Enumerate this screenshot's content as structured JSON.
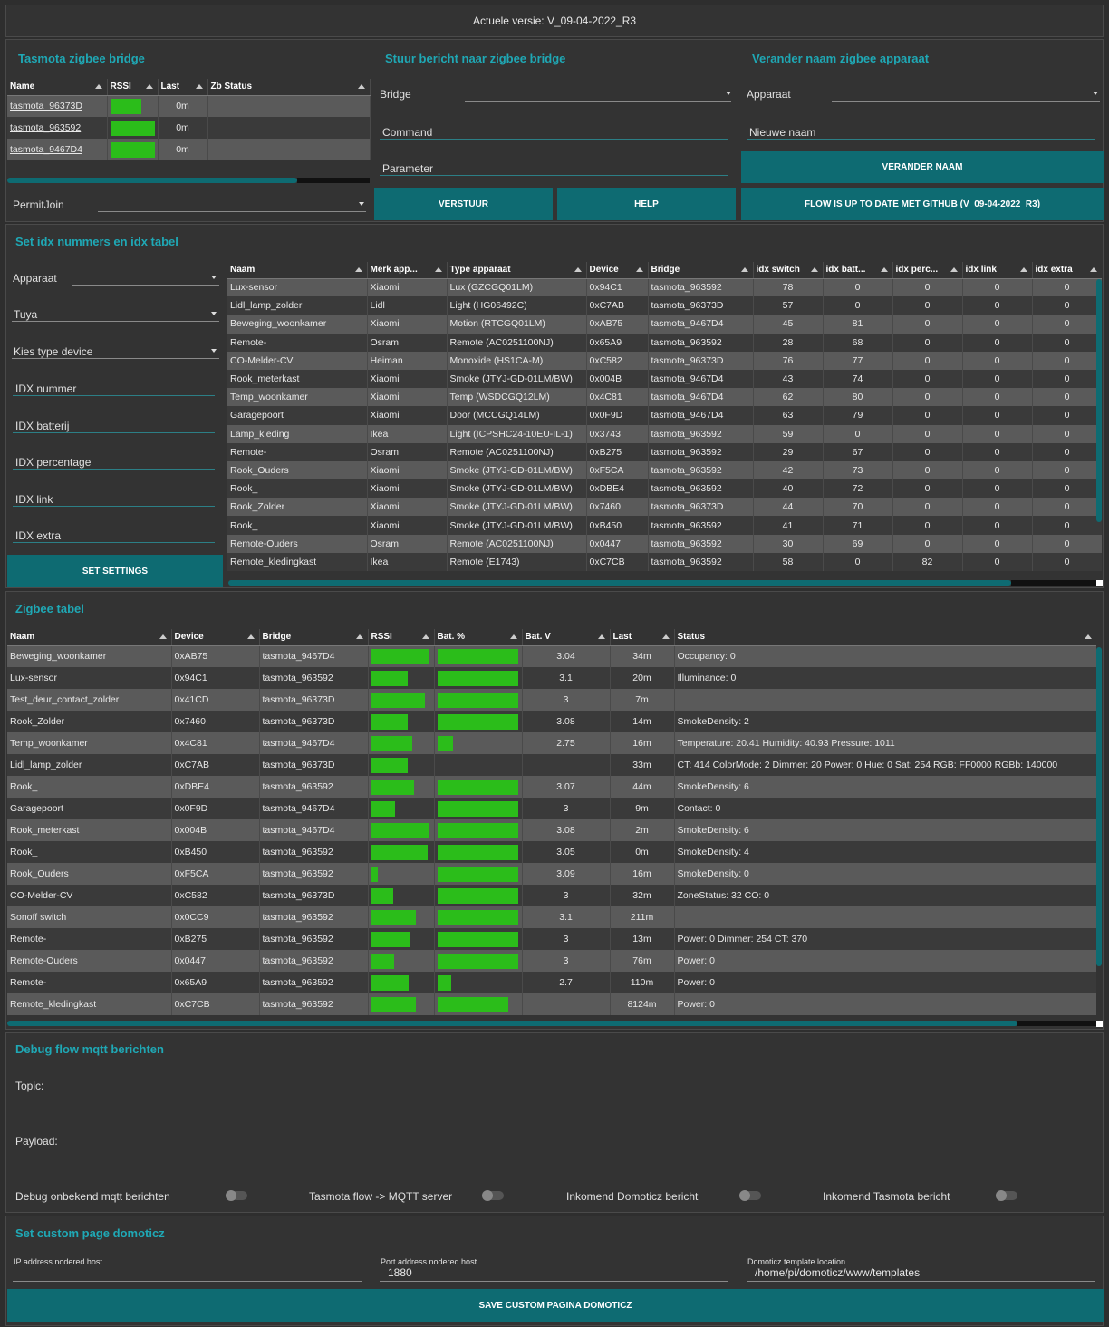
{
  "version_text": "Actuele versie: V_09-04-2022_R3",
  "bridge_panel": {
    "title": "Tasmota zigbee bridge",
    "columns": [
      "Name",
      "RSSI",
      "Last",
      "Zb Status"
    ],
    "rows": [
      {
        "name": "tasmota_96373D",
        "rssi": 0.7,
        "last": "0m",
        "status": ""
      },
      {
        "name": "tasmota_963592",
        "rssi": 1.0,
        "last": "0m",
        "status": ""
      },
      {
        "name": "tasmota_9467D4",
        "rssi": 1.0,
        "last": "0m",
        "status": ""
      }
    ],
    "permitjoin_label": "PermitJoin"
  },
  "send_panel": {
    "title": "Stuur bericht naar zigbee bridge",
    "bridge_label": "Bridge",
    "command_label": "Command",
    "parameter_label": "Parameter",
    "send_button": "VERSTUUR",
    "help_button": "HELP"
  },
  "rename_panel": {
    "title": "Verander naam zigbee apparaat",
    "device_label": "Apparaat",
    "new_name_label": "Nieuwe naam",
    "rename_button": "VERANDER NAAM",
    "flow_button": "FLOW IS UP TO DATE MET GITHUB (V_09-04-2022_R3)"
  },
  "idx_panel": {
    "title": "Set idx nummers en idx tabel",
    "fields": {
      "apparaat": "Apparaat",
      "tuya": "Tuya",
      "type": "Kies type device",
      "idx_nummer": "IDX nummer",
      "idx_batterij": "IDX batterij",
      "idx_percentage": "IDX percentage",
      "idx_link": "IDX link",
      "idx_extra": "IDX extra"
    },
    "set_button": "SET SETTINGS",
    "columns": [
      "Naam",
      "Merk app...",
      "Type apparaat",
      "Device",
      "Bridge",
      "idx switch",
      "idx batt...",
      "idx perc...",
      "idx link",
      "idx extra"
    ],
    "rows": [
      [
        "Lux-sensor",
        "Xiaomi",
        "Lux (GZCGQ01LM)",
        "0x94C1",
        "tasmota_963592",
        "78",
        "0",
        "0",
        "0",
        "0"
      ],
      [
        "Lidl_lamp_zolder",
        "Lidl",
        "Light (HG06492C)",
        "0xC7AB",
        "tasmota_96373D",
        "57",
        "0",
        "0",
        "0",
        "0"
      ],
      [
        "Beweging_woonkamer",
        "Xiaomi",
        "Motion (RTCGQ01LM)",
        "0xAB75",
        "tasmota_9467D4",
        "45",
        "81",
        "0",
        "0",
        "0"
      ],
      [
        "Remote-",
        "Osram",
        "Remote (AC0251100NJ)",
        "0x65A9",
        "tasmota_963592",
        "28",
        "68",
        "0",
        "0",
        "0"
      ],
      [
        "CO-Melder-CV",
        "Heiman",
        "Monoxide (HS1CA-M)",
        "0xC582",
        "tasmota_96373D",
        "76",
        "77",
        "0",
        "0",
        "0"
      ],
      [
        "Rook_meterkast",
        "Xiaomi",
        "Smoke (JTYJ-GD-01LM/BW)",
        "0x004B",
        "tasmota_9467D4",
        "43",
        "74",
        "0",
        "0",
        "0"
      ],
      [
        "Temp_woonkamer",
        "Xiaomi",
        "Temp (WSDCGQ12LM)",
        "0x4C81",
        "tasmota_9467D4",
        "62",
        "80",
        "0",
        "0",
        "0"
      ],
      [
        "Garagepoort",
        "Xiaomi",
        "Door (MCCGQ14LM)",
        "0x0F9D",
        "tasmota_9467D4",
        "63",
        "79",
        "0",
        "0",
        "0"
      ],
      [
        "Lamp_kleding",
        "Ikea",
        "Light (ICPSHC24-10EU-IL-1)",
        "0x3743",
        "tasmota_963592",
        "59",
        "0",
        "0",
        "0",
        "0"
      ],
      [
        "Remote-",
        "Osram",
        "Remote (AC0251100NJ)",
        "0xB275",
        "tasmota_963592",
        "29",
        "67",
        "0",
        "0",
        "0"
      ],
      [
        "Rook_Ouders",
        "Xiaomi",
        "Smoke (JTYJ-GD-01LM/BW)",
        "0xF5CA",
        "tasmota_963592",
        "42",
        "73",
        "0",
        "0",
        "0"
      ],
      [
        "Rook_",
        "Xiaomi",
        "Smoke (JTYJ-GD-01LM/BW)",
        "0xDBE4",
        "tasmota_963592",
        "40",
        "72",
        "0",
        "0",
        "0"
      ],
      [
        "Rook_Zolder",
        "Xiaomi",
        "Smoke (JTYJ-GD-01LM/BW)",
        "0x7460",
        "tasmota_96373D",
        "44",
        "70",
        "0",
        "0",
        "0"
      ],
      [
        "Rook_",
        "Xiaomi",
        "Smoke (JTYJ-GD-01LM/BW)",
        "0xB450",
        "tasmota_963592",
        "41",
        "71",
        "0",
        "0",
        "0"
      ],
      [
        "Remote-Ouders",
        "Osram",
        "Remote (AC0251100NJ)",
        "0x0447",
        "tasmota_963592",
        "30",
        "69",
        "0",
        "0",
        "0"
      ],
      [
        "Remote_kledingkast",
        "Ikea",
        "Remote (E1743)",
        "0xC7CB",
        "tasmota_963592",
        "58",
        "0",
        "82",
        "0",
        "0"
      ]
    ]
  },
  "zigbee_panel": {
    "title": "Zigbee tabel",
    "columns": [
      "Naam",
      "Device",
      "Bridge",
      "RSSI",
      "Bat. %",
      "Bat. V",
      "Last",
      "Status"
    ],
    "rows": [
      {
        "naam": "Beweging_woonkamer",
        "device": "0xAB75",
        "bridge": "tasmota_9467D4",
        "rssi": 0.97,
        "bat": 1.0,
        "batv": "3.04",
        "last": "34m",
        "status": "Occupancy: 0"
      },
      {
        "naam": "Lux-sensor",
        "device": "0x94C1",
        "bridge": "tasmota_963592",
        "rssi": 0.61,
        "bat": 1.0,
        "batv": "3.1",
        "last": "20m",
        "status": "Illuminance: 0"
      },
      {
        "naam": "Test_deur_contact_zolder",
        "device": "0x41CD",
        "bridge": "tasmota_96373D",
        "rssi": 0.9,
        "bat": 1.0,
        "batv": "3",
        "last": "7m",
        "status": ""
      },
      {
        "naam": "Rook_Zolder",
        "device": "0x7460",
        "bridge": "tasmota_96373D",
        "rssi": 0.61,
        "bat": 1.0,
        "batv": "3.08",
        "last": "14m",
        "status": "SmokeDensity: 2"
      },
      {
        "naam": "Temp_woonkamer",
        "device": "0x4C81",
        "bridge": "tasmota_9467D4",
        "rssi": 0.68,
        "bat": 0.19,
        "batv": "2.75",
        "last": "16m",
        "status": "Temperature: 20.41 Humidity: 40.93 Pressure: 1011"
      },
      {
        "naam": "Lidl_lamp_zolder",
        "device": "0xC7AB",
        "bridge": "tasmota_96373D",
        "rssi": 0.61,
        "bat": 0,
        "batv": "",
        "last": "33m",
        "status": "CT: 414 ColorMode: 2 Dimmer: 20 Power: 0 Hue: 0 Sat: 254 RGB: FF0000 RGBb: 140000"
      },
      {
        "naam": "Rook_",
        "device": "0xDBE4",
        "bridge": "tasmota_963592",
        "rssi": 0.71,
        "bat": 1.0,
        "batv": "3.07",
        "last": "44m",
        "status": "SmokeDensity: 6"
      },
      {
        "naam": "Garagepoort",
        "device": "0x0F9D",
        "bridge": "tasmota_9467D4",
        "rssi": 0.4,
        "bat": 1.0,
        "batv": "3",
        "last": "9m",
        "status": "Contact: 0"
      },
      {
        "naam": "Rook_meterkast",
        "device": "0x004B",
        "bridge": "tasmota_9467D4",
        "rssi": 0.97,
        "bat": 1.0,
        "batv": "3.08",
        "last": "2m",
        "status": "SmokeDensity: 6"
      },
      {
        "naam": "Rook_",
        "device": "0xB450",
        "bridge": "tasmota_963592",
        "rssi": 0.94,
        "bat": 1.0,
        "batv": "3.05",
        "last": "0m",
        "status": "SmokeDensity: 4"
      },
      {
        "naam": "Rook_Ouders",
        "device": "0xF5CA",
        "bridge": "tasmota_963592",
        "rssi": 0.11,
        "bat": 1.0,
        "batv": "3.09",
        "last": "16m",
        "status": "SmokeDensity: 0"
      },
      {
        "naam": "CO-Melder-CV",
        "device": "0xC582",
        "bridge": "tasmota_96373D",
        "rssi": 0.36,
        "bat": 1.0,
        "batv": "3",
        "last": "32m",
        "status": "ZoneStatus: 32 CO: 0"
      },
      {
        "naam": "Sonoff switch",
        "device": "0x0CC9",
        "bridge": "tasmota_963592",
        "rssi": 0.74,
        "bat": 1.0,
        "batv": "3.1",
        "last": "211m",
        "status": ""
      },
      {
        "naam": "Remote-",
        "device": "0xB275",
        "bridge": "tasmota_963592",
        "rssi": 0.65,
        "bat": 1.0,
        "batv": "3",
        "last": "13m",
        "status": "Power: 0 Dimmer: 254 CT: 370"
      },
      {
        "naam": "Remote-Ouders",
        "device": "0x0447",
        "bridge": "tasmota_963592",
        "rssi": 0.38,
        "bat": 1.0,
        "batv": "3",
        "last": "76m",
        "status": "Power: 0"
      },
      {
        "naam": "Remote-",
        "device": "0x65A9",
        "bridge": "tasmota_963592",
        "rssi": 0.62,
        "bat": 0.17,
        "batv": "2.7",
        "last": "110m",
        "status": "Power: 0"
      },
      {
        "naam": "Remote_kledingkast",
        "device": "0xC7CB",
        "bridge": "tasmota_963592",
        "rssi": 0.74,
        "bat": 0.88,
        "batv": "",
        "last": "8124m",
        "status": "Power: 0"
      }
    ]
  },
  "debug_panel": {
    "title": "Debug flow mqtt berichten",
    "topic_label": "Topic:",
    "payload_label": "Payload:",
    "toggles": [
      "Debug onbekend mqtt berichten",
      "Tasmota flow -> MQTT server",
      "Inkomend Domoticz bericht",
      "Inkomend Tasmota bericht"
    ]
  },
  "custom_panel": {
    "title": "Set custom page domoticz",
    "ip_label": "IP address nodered host",
    "ip_value": "",
    "port_label": "Port address nodered host",
    "port_value": "1880",
    "template_label": "Domoticz template location",
    "template_value": "/home/pi/domoticz/www/templates",
    "save_button": "SAVE CUSTOM PAGINA DOMOTICZ"
  },
  "colors": {
    "accent": "#1fa8b5",
    "button": "#0e6b72",
    "bar": "#2bbd1a"
  }
}
